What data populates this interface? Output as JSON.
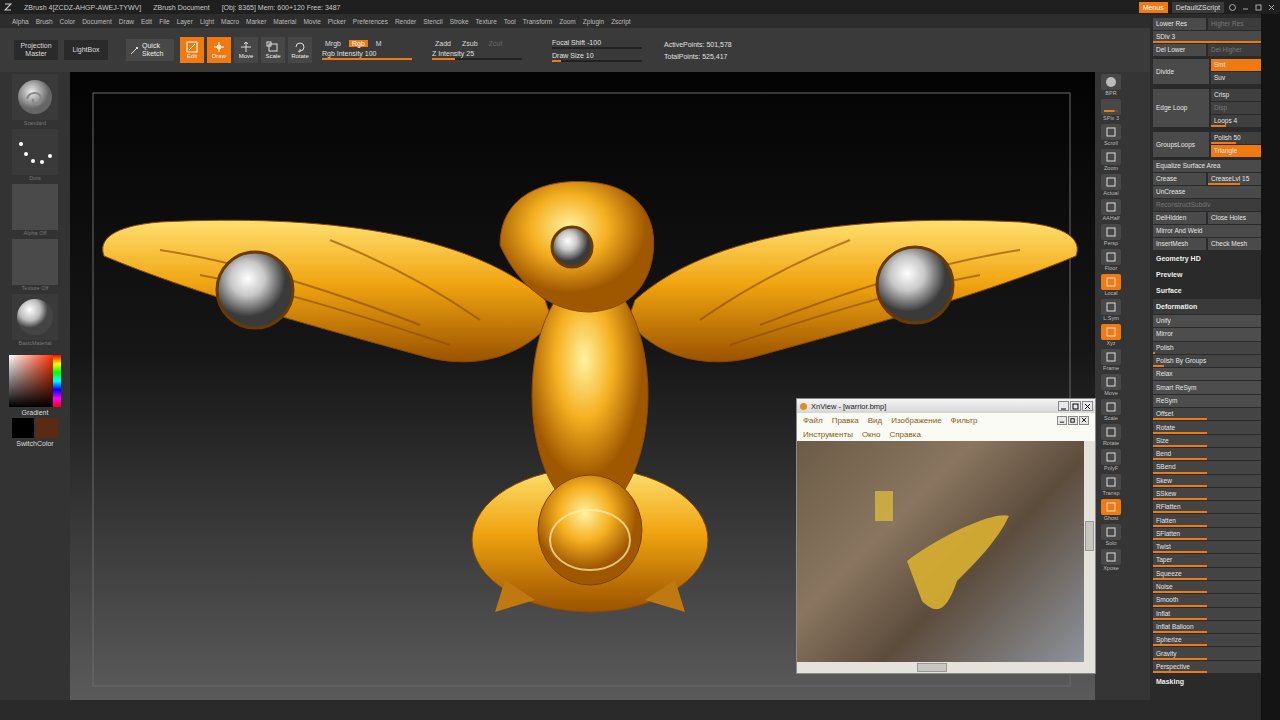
{
  "titlebar": {
    "app": "ZBrush 4[ZCDZ-AHGP-AWEJ-TYWV]",
    "document": "ZBrush Document",
    "stats": "[Obj: 8365] Mem: 600+120 Free: 3487",
    "buttons": [
      {
        "label": "Menus",
        "active": true
      },
      {
        "label": "DefaultZScript",
        "active": false
      }
    ]
  },
  "menubar": [
    "Alpha",
    "Brush",
    "Color",
    "Document",
    "Draw",
    "Edit",
    "File",
    "Layer",
    "Light",
    "Macro",
    "Marker",
    "Material",
    "Movie",
    "Picker",
    "Preferences",
    "Render",
    "Stencil",
    "Stroke",
    "Texture",
    "Tool",
    "Transform",
    "Zoom",
    "Zplugin",
    "Zscript"
  ],
  "top_shelf": {
    "buttons": [
      "Projection Master",
      "LightBox"
    ],
    "quick_sketch": "Quick Sketch",
    "modes": [
      {
        "label": "Edit",
        "kind": "edit",
        "selected": true
      },
      {
        "label": "Draw",
        "kind": "draw",
        "selected": true
      },
      {
        "label": "Move",
        "kind": "move",
        "selected": false
      },
      {
        "label": "Scale",
        "kind": "scale",
        "selected": false
      },
      {
        "label": "Rotate",
        "kind": "rotate",
        "selected": false
      }
    ],
    "color_modes": [
      {
        "label": "Mrgb",
        "selected": false
      },
      {
        "label": "Rgb",
        "selected": true
      },
      {
        "label": "M",
        "selected": false
      }
    ],
    "rgb_intensity": {
      "label": "Rgb Intensity 100",
      "level": 1
    },
    "z_modes": [
      {
        "label": "Zadd",
        "selected": false,
        "disabled": false
      },
      {
        "label": "Zsub",
        "selected": false,
        "disabled": false
      },
      {
        "label": "Zcut",
        "selected": false,
        "disabled": true
      }
    ],
    "z_intensity": {
      "label": "Z Intensity 25",
      "level": 0.25
    },
    "focal_shift": {
      "label": "Focal Shift -100",
      "level": 0
    },
    "draw_size": {
      "label": "Draw Size 10",
      "level": 0.1
    },
    "points": [
      "ActivePoints: 501,578",
      "TotalPoints: 525,417"
    ]
  },
  "left_shelf": {
    "items": [
      {
        "label": "Standard",
        "kind": "brush"
      },
      {
        "label": "Dots",
        "kind": "stroke"
      },
      {
        "label": "Alpha Off",
        "kind": "empty"
      },
      {
        "label": "Texture Off",
        "kind": "empty"
      },
      {
        "label": "BasicMaterial",
        "kind": "material"
      }
    ],
    "gradient": "Gradient",
    "switch": "SwitchColor",
    "main_color": "#000000",
    "secondary_color": "#5a2a12"
  },
  "right_shelf": [
    {
      "label": "BPR",
      "kind": "render",
      "active": false
    },
    {
      "label": "SPix 3",
      "kind": "slider",
      "level": 0.75,
      "active": false
    },
    {
      "label": "Scroll",
      "kind": "tool",
      "active": false
    },
    {
      "label": "Zoom",
      "kind": "tool",
      "active": false
    },
    {
      "label": "Actual",
      "kind": "tool",
      "active": false
    },
    {
      "label": "AAHalf",
      "kind": "tool",
      "active": false
    },
    {
      "label": "Persp",
      "kind": "tool",
      "active": false
    },
    {
      "label": "Floor",
      "kind": "tool",
      "active": false
    },
    {
      "label": "Local",
      "kind": "tool",
      "active": true
    },
    {
      "label": "L.Sym",
      "kind": "tool",
      "active": false
    },
    {
      "label": "Xyz",
      "kind": "tool",
      "active": true
    },
    {
      "label": "Frame",
      "kind": "tool",
      "active": false
    },
    {
      "label": "Move",
      "kind": "tool",
      "active": false
    },
    {
      "label": "Scale",
      "kind": "tool",
      "active": false
    },
    {
      "label": "Rotate",
      "kind": "tool",
      "active": false
    },
    {
      "label": "PolyF",
      "kind": "tool",
      "active": false
    },
    {
      "label": "Transp",
      "kind": "tool",
      "active": false
    },
    {
      "label": "Ghost",
      "kind": "tool",
      "active": true
    },
    {
      "label": "Solo",
      "kind": "tool",
      "active": false
    },
    {
      "label": "Xpose",
      "kind": "tool",
      "active": false
    }
  ],
  "panel": [
    {
      "kind": "pair",
      "cells": [
        {
          "label": "Lower Res",
          "disabled": false
        },
        {
          "label": "Higher Res",
          "disabled": true
        }
      ]
    },
    {
      "kind": "slider",
      "label": "SDiv 3",
      "level": 1
    },
    {
      "kind": "pair",
      "cells": [
        {
          "label": "Del Lower",
          "disabled": false
        },
        {
          "label": "Del Higher",
          "disabled": true
        }
      ]
    },
    {
      "kind": "group",
      "label": "Divide",
      "options": [
        {
          "label": "Smt",
          "kind": "toggle",
          "active": true,
          "disabled": false
        },
        {
          "label": "Suv",
          "kind": "toggle",
          "active": false,
          "disabled": false
        }
      ]
    },
    {
      "kind": "group",
      "label": "Edge Loop",
      "options": [
        {
          "label": "Crisp",
          "kind": "toggle",
          "active": false,
          "disabled": false
        },
        {
          "label": "Disp",
          "kind": "toggle",
          "active": false,
          "disabled": true
        },
        {
          "label": "Loops 4",
          "kind": "slider",
          "level": 0.3,
          "active": false,
          "disabled": false
        }
      ]
    },
    {
      "kind": "group",
      "label": "GroupsLoops",
      "options": [
        {
          "label": "Polish 50",
          "kind": "slider",
          "level": 0.5,
          "active": false,
          "disabled": false
        },
        {
          "label": "Triangle",
          "kind": "toggle",
          "active": true,
          "disabled": false
        }
      ]
    },
    {
      "kind": "pair",
      "cells": [
        {
          "label": "Equalize Surface Area",
          "disabled": false
        }
      ]
    },
    {
      "kind": "pair",
      "cells": [
        {
          "label": "Crease",
          "disabled": false
        },
        {
          "label": "CreaseLvl 15",
          "disabled": false,
          "level": 0.6
        }
      ]
    },
    {
      "kind": "pair",
      "cells": [
        {
          "label": "UnCrease",
          "disabled": false
        }
      ]
    },
    {
      "kind": "pair",
      "cells": [
        {
          "label": "ReconstructSubdiv",
          "disabled": true
        }
      ]
    },
    {
      "kind": "pair",
      "cells": [
        {
          "label": "DelHidden",
          "disabled": false
        },
        {
          "label": "Close Holes",
          "disabled": false
        }
      ]
    },
    {
      "kind": "pair",
      "cells": [
        {
          "label": "Mirror And Weld",
          "disabled": false
        }
      ]
    },
    {
      "kind": "pair",
      "cells": [
        {
          "label": "InsertMesh",
          "disabled": false
        },
        {
          "label": "Check Mesh",
          "disabled": false
        }
      ]
    },
    {
      "kind": "section",
      "label": "Geometry HD",
      "expanded": false
    },
    {
      "kind": "section",
      "label": "Preview",
      "expanded": false
    },
    {
      "kind": "section",
      "label": "Surface",
      "expanded": false
    },
    {
      "kind": "section",
      "label": "Deformation",
      "expanded": true
    },
    {
      "kind": "deform",
      "items": [
        {
          "label": "Unify",
          "kind": "button"
        },
        {
          "label": "Mirror",
          "kind": "button"
        },
        {
          "label": "Polish",
          "kind": "slider",
          "level": 0.02
        },
        {
          "label": "Polish By Groups",
          "kind": "slider",
          "level": 0.1
        },
        {
          "label": "Relax",
          "kind": "button"
        },
        {
          "label": "Smart ReSym",
          "kind": "button"
        },
        {
          "label": "ReSym",
          "kind": "button"
        },
        {
          "label": "Offset",
          "kind": "slider",
          "level": 0.5
        },
        {
          "label": "Rotate",
          "kind": "slider",
          "level": 0.5
        },
        {
          "label": "Size",
          "kind": "slider",
          "level": 0.5
        },
        {
          "label": "Bend",
          "kind": "slider",
          "level": 0.5
        },
        {
          "label": "SBend",
          "kind": "slider",
          "level": 0.5
        },
        {
          "label": "Skew",
          "kind": "slider",
          "level": 0.5
        },
        {
          "label": "SSkew",
          "kind": "slider",
          "level": 0.5
        },
        {
          "label": "RFlatten",
          "kind": "slider",
          "level": 0.5
        },
        {
          "label": "Flatten",
          "kind": "slider",
          "level": 0.5
        },
        {
          "label": "SFlatten",
          "kind": "slider",
          "level": 0.5
        },
        {
          "label": "Twist",
          "kind": "slider",
          "level": 0.5
        },
        {
          "label": "Taper",
          "kind": "slider",
          "level": 0.5
        },
        {
          "label": "Squeeze",
          "kind": "slider",
          "level": 0.5
        },
        {
          "label": "Noise",
          "kind": "slider",
          "level": 0.5
        },
        {
          "label": "Smooth",
          "kind": "slider",
          "level": 0.5
        },
        {
          "label": "Inflat",
          "kind": "slider",
          "level": 0.5
        },
        {
          "label": "Inflat Balloon",
          "kind": "slider",
          "level": 0.5
        },
        {
          "label": "Spherize",
          "kind": "slider",
          "level": 0.5
        },
        {
          "label": "Gravity",
          "kind": "slider",
          "level": 0.5
        },
        {
          "label": "Perspective",
          "kind": "slider",
          "level": 0.5
        }
      ]
    },
    {
      "kind": "section",
      "label": "Masking",
      "expanded": false
    }
  ],
  "xnview": {
    "title": "XnView - [warrior.bmp]",
    "menu": [
      [
        "Файл",
        "Правка",
        "Вид",
        "Изображение",
        "Фильтр"
      ],
      [
        "Инструменты",
        "Окно",
        "Справка"
      ]
    ]
  }
}
